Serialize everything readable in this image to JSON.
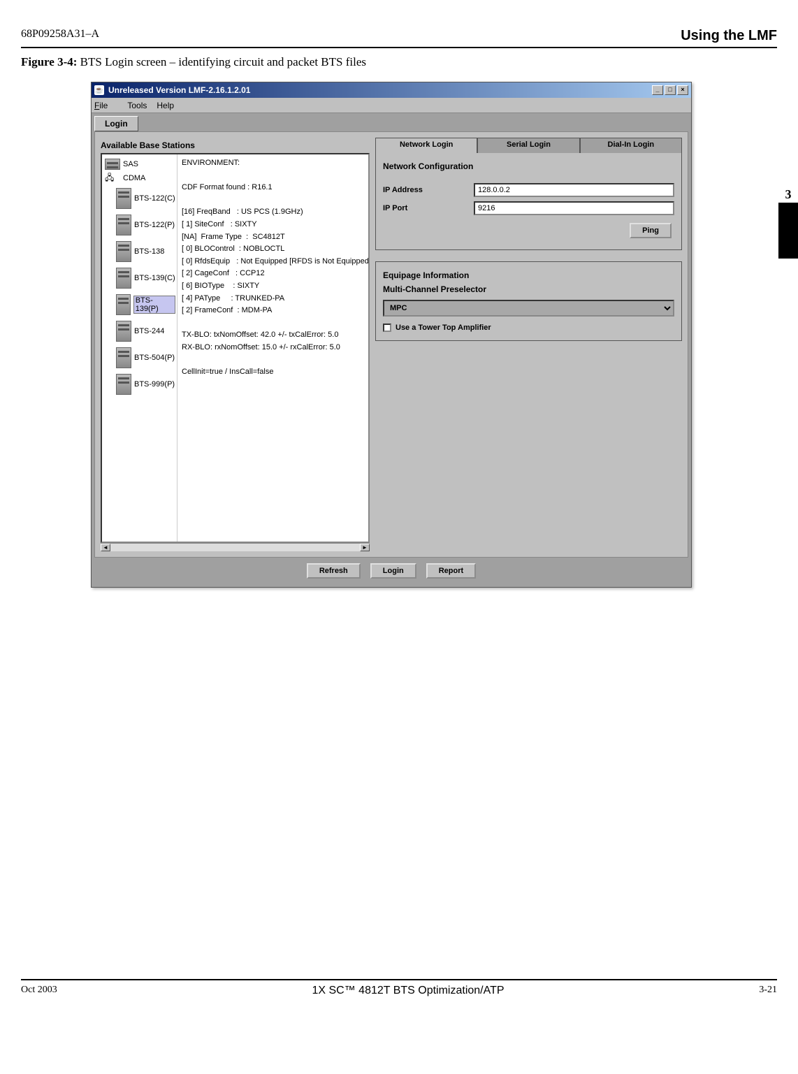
{
  "header": {
    "doc_id": "68P09258A31–A",
    "section": "Using the LMF"
  },
  "figure": {
    "label": "Figure 3-4:",
    "caption": "BTS Login screen – identifying circuit and packet BTS files"
  },
  "side_chapter": "3",
  "footer": {
    "left": "Oct 2003",
    "center": "1X SC™ 4812T BTS Optimization/ATP",
    "right": "3-21"
  },
  "window": {
    "title": "Unreleased Version LMF-2.16.1.2.01",
    "wincontrols": {
      "min": "_",
      "max": "□",
      "close": "×"
    },
    "menu": {
      "file": "File",
      "tools": "Tools",
      "help": "Help"
    },
    "main_tab": "Login",
    "avail_label": "Available Base Stations",
    "tree": {
      "root1": "SAS",
      "root2": "CDMA",
      "items": [
        "BTS-122(C)",
        "BTS-122(P)",
        "BTS-138",
        "BTS-139(C)",
        "BTS-139(P)",
        "BTS-244",
        "BTS-504(P)",
        "BTS-999(P)"
      ],
      "selected_index": 4
    },
    "env_text": "ENVIRONMENT:\n\nCDF Format found : R16.1\n\n[16] FreqBand   : US PCS (1.9GHz)\n[ 1] SiteConf   : SIXTY\n[NA]  Frame Type  :  SC4812T\n[ 0] BLOControl  : NOBLOCTL\n[ 0] RfdsEquip   : Not Equipped [RFDS is Not Equipped]\n[ 2] CageConf   : CCP12\n[ 6] BIOType    : SIXTY\n[ 4] PAType     : TRUNKED-PA\n[ 2] FrameConf  : MDM-PA\n\nTX-BLO: txNomOffset: 42.0 +/- txCalError: 5.0\nRX-BLO: rxNomOffset: 15.0 +/- rxCalError: 5.0\n\nCellInit=true / InsCall=false",
    "right": {
      "tabs": {
        "net": "Network Login",
        "serial": "Serial Login",
        "dial": "Dial-In Login"
      },
      "netconf_label": "Network Configuration",
      "ip_addr_label": "IP Address",
      "ip_addr_value": "128.0.0.2",
      "ip_port_label": "IP Port",
      "ip_port_value": "9216",
      "ping": "Ping",
      "equip_label": "Equipage Information",
      "mcp_label": "Multi-Channel Preselector",
      "mcp_value": "MPC",
      "tta_label": "Use a Tower Top Amplifier"
    },
    "buttons": {
      "refresh": "Refresh",
      "login": "Login",
      "report": "Report"
    }
  }
}
